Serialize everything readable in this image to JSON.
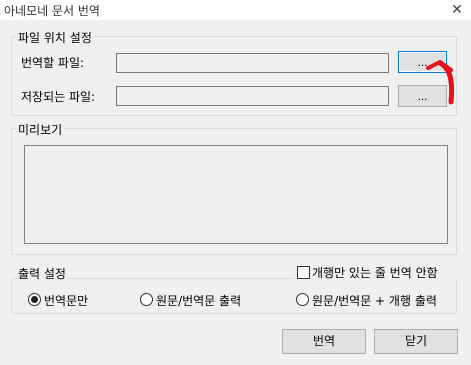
{
  "window": {
    "title": "아네모네 문서 번역",
    "close_glyph": "✕"
  },
  "file_location": {
    "legend": "파일 위치 설정",
    "source_label": "번역할 파일:",
    "source_value": "",
    "source_browse": "...",
    "dest_label": "저장되는 파일:",
    "dest_value": "",
    "dest_browse": "..."
  },
  "preview": {
    "legend": "미리보기",
    "content": ""
  },
  "output": {
    "legend": "출력 설정",
    "no_linebreak_checkbox": {
      "label": "개행만 있는 줄 번역 안함",
      "checked": false
    },
    "options": [
      {
        "label": "번역문만",
        "checked": true
      },
      {
        "label": "원문/번역문 출력",
        "checked": false
      },
      {
        "label": "원문/번역문 + 개행 출력",
        "checked": false
      }
    ]
  },
  "buttons": {
    "translate": "번역",
    "close": "닫기"
  },
  "annotation": {
    "color": "#e8101a"
  }
}
